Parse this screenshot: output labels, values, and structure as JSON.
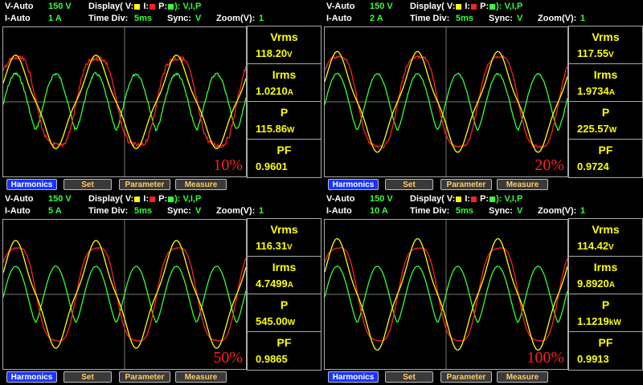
{
  "colors": {
    "voltage": "#ffff00",
    "current": "#ff2020",
    "power": "#33ff33",
    "accent": "#1a33ff"
  },
  "panels": [
    {
      "v_range": "V-Auto",
      "v_val": "150 V",
      "i_range": "I-Auto",
      "i_val": "1 A",
      "display_label": "Display( V:",
      "i_label": "I:",
      "p_label": "P:",
      "display_tail": "): V,I,P",
      "time_label": "Time Div:",
      "time_val": "5ms",
      "sync_label": "Sync:",
      "sync_val": "V",
      "zoom_label": "Zoom(V):",
      "zoom_val": "1",
      "vrms_label": "Vrms",
      "vrms": "118.20",
      "vrms_unit": "V",
      "irms_label": "Irms",
      "irms": "1.0210",
      "irms_unit": "A",
      "p_label2": "P",
      "p": "115.86",
      "p_unit": "W",
      "pf_label": "PF",
      "pf": "0.9601",
      "pct": "10%",
      "tabs": [
        "Harmonics",
        "Set",
        "Parameter",
        "Measure"
      ]
    },
    {
      "v_range": "V-Auto",
      "v_val": "150 V",
      "i_range": "I-Auto",
      "i_val": "2 A",
      "display_label": "Display( V:",
      "i_label": "I:",
      "p_label": "P:",
      "display_tail": "): V,I,P",
      "time_label": "Time Div:",
      "time_val": "5ms",
      "sync_label": "Sync:",
      "sync_val": "V",
      "zoom_label": "Zoom(V):",
      "zoom_val": "1",
      "vrms_label": "Vrms",
      "vrms": "117.55",
      "vrms_unit": "V",
      "irms_label": "Irms",
      "irms": "1.9734",
      "irms_unit": "A",
      "p_label2": "P",
      "p": "225.57",
      "p_unit": "W",
      "pf_label": "PF",
      "pf": "0.9724",
      "pct": "20%",
      "tabs": [
        "Harmonics",
        "Set",
        "Parameter",
        "Measure"
      ]
    },
    {
      "v_range": "V-Auto",
      "v_val": "150 V",
      "i_range": "I-Auto",
      "i_val": "5 A",
      "display_label": "Display( V:",
      "i_label": "I:",
      "p_label": "P:",
      "display_tail": "): V,I,P",
      "time_label": "Time Div:",
      "time_val": "5ms",
      "sync_label": "Sync:",
      "sync_val": "V",
      "zoom_label": "Zoom(V):",
      "zoom_val": "1",
      "vrms_label": "Vrms",
      "vrms": "116.31",
      "vrms_unit": "V",
      "irms_label": "Irms",
      "irms": "4.7499",
      "irms_unit": "A",
      "p_label2": "P",
      "p": "545.00",
      "p_unit": "W",
      "pf_label": "PF",
      "pf": "0.9865",
      "pct": "50%",
      "tabs": [
        "Harmonics",
        "Set",
        "Parameter",
        "Measure"
      ]
    },
    {
      "v_range": "V-Auto",
      "v_val": "150 V",
      "i_range": "I-Auto",
      "i_val": "10 A",
      "display_label": "Display( V:",
      "i_label": "I:",
      "p_label": "P:",
      "display_tail": "): V,I,P",
      "time_label": "Time Div:",
      "time_val": "5ms",
      "sync_label": "Sync:",
      "sync_val": "V",
      "zoom_label": "Zoom(V):",
      "zoom_val": "1",
      "vrms_label": "Vrms",
      "vrms": "114.42",
      "vrms_unit": "V",
      "irms_label": "Irms",
      "irms": "9.8920",
      "irms_unit": "A",
      "p_label2": "P",
      "p": "1.1219",
      "p_unit": "kW",
      "pf_label": "PF",
      "pf": "0.9913",
      "pct": "100%",
      "tabs": [
        "Harmonics",
        "Set",
        "Parameter",
        "Measure"
      ]
    }
  ]
}
